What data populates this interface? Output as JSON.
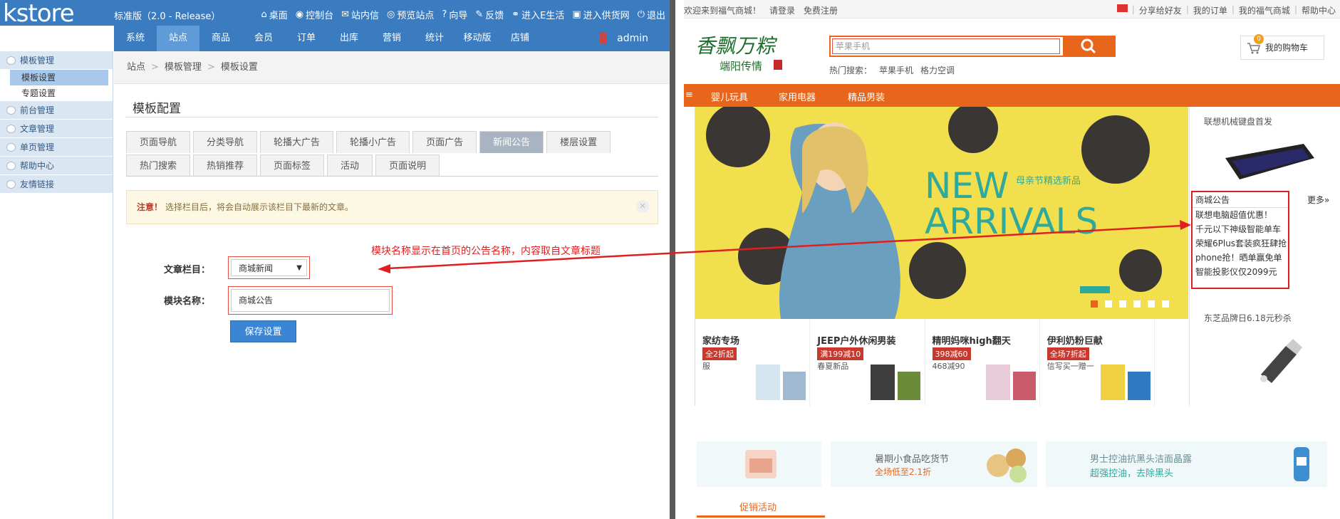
{
  "admin": {
    "logo": "kstore",
    "version": "标准版（2.0 - Release）",
    "toplinks": [
      {
        "icon": "home-icon",
        "label": "桌面"
      },
      {
        "icon": "dashboard-icon",
        "label": "控制台"
      },
      {
        "icon": "mail-icon",
        "label": "站内信"
      },
      {
        "icon": "eye-icon",
        "label": "预览站点"
      },
      {
        "icon": "help-icon",
        "label": "向导"
      },
      {
        "icon": "edit-icon",
        "label": "反馈"
      },
      {
        "icon": "link-icon",
        "label": "进入E生活"
      },
      {
        "icon": "truck-icon",
        "label": "进入供货网"
      },
      {
        "icon": "power-icon",
        "label": "退出"
      }
    ],
    "menu": [
      "系统",
      "站点",
      "商品",
      "会员",
      "订单",
      "出库",
      "营销",
      "统计",
      "移动版",
      "店铺"
    ],
    "user": "admin",
    "sidebar": {
      "groups": [
        {
          "label": "模板管理",
          "items": [
            "模板设置",
            "专题设置"
          ]
        },
        {
          "label": "前台管理",
          "items": []
        },
        {
          "label": "文章管理",
          "items": []
        },
        {
          "label": "单页管理",
          "items": []
        },
        {
          "label": "帮助中心",
          "items": []
        },
        {
          "label": "友情链接",
          "items": []
        }
      ]
    },
    "breadcrumb": [
      "站点",
      "模板管理",
      "模板设置"
    ],
    "page_title": "模板配置",
    "tabs_row1": [
      "页面导航",
      "分类导航",
      "轮播大广告",
      "轮播小广告",
      "页面广告",
      "新闻公告",
      "楼层设置"
    ],
    "tabs_row2": [
      "热门搜索",
      "热销推荐",
      "页面标签",
      "活动",
      "页面说明"
    ],
    "notice": {
      "strong": "注意！",
      "text": "选择栏目后，将会自动展示该栏目下最新的文章。"
    },
    "form": {
      "category_label": "文章栏目：",
      "category_value": "商城新闻",
      "module_label": "模块名称：",
      "module_value": "商城公告",
      "save_label": "保存设置"
    }
  },
  "annotation": "模块名称显示在首页的公告名称，内容取自文章标题",
  "store": {
    "welcome": "欢迎来到福气商城！",
    "login": "请登录",
    "register": "免费注册",
    "top_right": [
      "分享给好友",
      "我的订单",
      "我的福气商城",
      "帮助中心"
    ],
    "search_placeholder": "苹果手机",
    "hot_label": "热门搜索：",
    "hot_items": [
      "苹果手机",
      "格力空调"
    ],
    "cart_count": "0",
    "cart_label": "我的购物车",
    "nav": [
      "婴儿玩具",
      "家用电器",
      "精品男装"
    ],
    "banner": {
      "title1": "NEW",
      "title2": "ARRIVALS",
      "subtitle": "母亲节精选新品"
    },
    "side_ad_top": "联想机械键盘首发",
    "notice_title": "商城公告",
    "notice_more": "更多»",
    "notice_items": [
      "联想电脑超值优惠！",
      "千元以下神级智能单车",
      "荣耀6Plus套装疯狂肆抢",
      "phone抢！晒单赢免单",
      "智能投影仪仅2099元"
    ],
    "side_ad_bottom": "东芝品牌日6.18元秒杀",
    "products": [
      {
        "title": "家纺专场",
        "tag": "全2折起",
        "sub": "服"
      },
      {
        "title": "JEEP户外休闲男装",
        "tag": "满199减10",
        "sub": "春夏新品"
      },
      {
        "title": "精明妈咪high翻天",
        "tag": "398减60",
        "sub": "468减90"
      },
      {
        "title": "伊利奶粉巨献",
        "tag": "全场7折起",
        "sub": "信写买一赠一"
      }
    ],
    "bottom_ads": [
      {
        "title": "暑期小食品吃货节",
        "sub": "全场低至2.1折"
      },
      {
        "title": "男士控油抗黑头洁面晶露",
        "sub": "超强控油，去除黑头"
      }
    ],
    "promo_tab": "促销活动"
  }
}
